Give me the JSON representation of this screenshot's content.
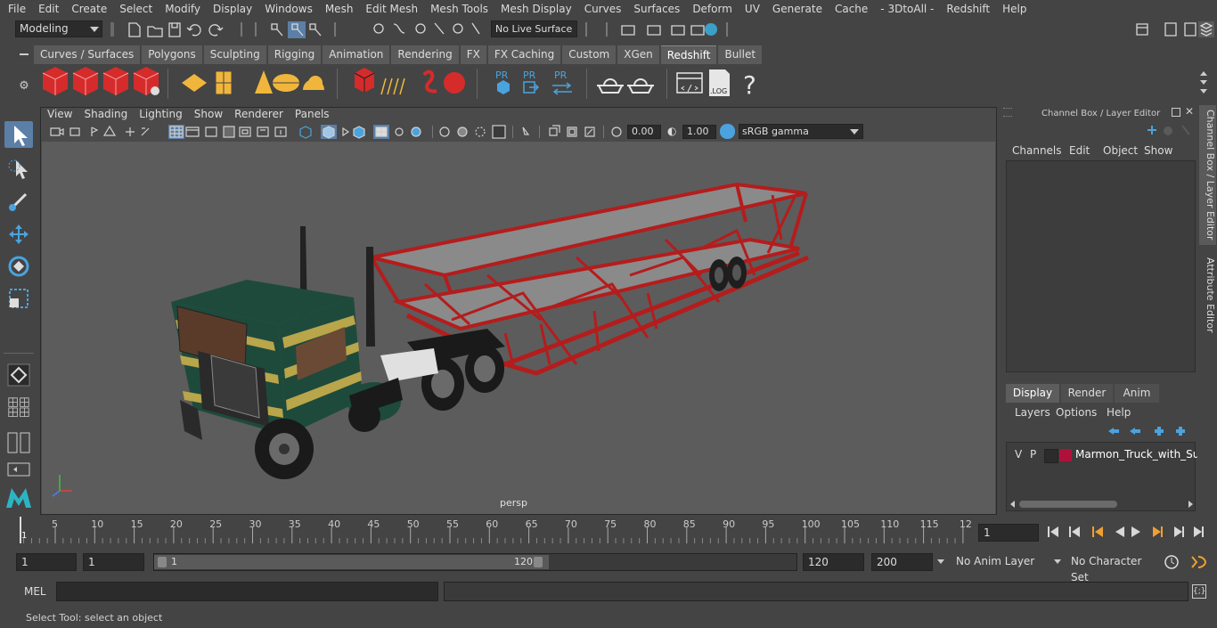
{
  "menubar": [
    "File",
    "Edit",
    "Create",
    "Select",
    "Modify",
    "Display",
    "Windows",
    "Mesh",
    "Edit Mesh",
    "Mesh Tools",
    "Mesh Display",
    "Curves",
    "Surfaces",
    "Deform",
    "UV",
    "Generate",
    "Cache",
    "- 3DtoAll -",
    "Redshift",
    "Help"
  ],
  "status": {
    "mode": "Modeling",
    "live_surface": "No Live Surface"
  },
  "shelf_tabs": [
    "Curves / Surfaces",
    "Polygons",
    "Sculpting",
    "Rigging",
    "Animation",
    "Rendering",
    "FX",
    "FX Caching",
    "Custom",
    "XGen",
    "Redshift",
    "Bullet"
  ],
  "shelf_active": "Redshift",
  "shelf_labels": {
    "rv": "RV",
    "ipr": "IPR",
    "pr1": "PR",
    "pr2": "PR",
    "pr3": "PR",
    "log": ".LOG",
    "help": "?"
  },
  "viewport": {
    "menu": [
      "View",
      "Shading",
      "Lighting",
      "Show",
      "Renderer",
      "Panels"
    ],
    "exposure": "0.00",
    "gamma": "1.00",
    "colorspace": "sRGB gamma",
    "camera": "persp"
  },
  "channel_box": {
    "title": "Channel Box / Layer Editor",
    "menu": [
      "Channels",
      "Edit",
      "Object",
      "Show"
    ]
  },
  "layer_editor": {
    "tabs": [
      "Display",
      "Render",
      "Anim"
    ],
    "active_tab": "Display",
    "menu": [
      "Layers",
      "Options",
      "Help"
    ],
    "layers": [
      {
        "v": "V",
        "p": "P",
        "name": "Marmon_Truck_with_Sun_",
        "color": "#b0113a"
      }
    ]
  },
  "side_tabs": [
    "Channel Box / Layer Editor",
    "Attribute Editor"
  ],
  "timeline": {
    "ticks": [
      "5",
      "10",
      "15",
      "20",
      "25",
      "30",
      "35",
      "40",
      "45",
      "50",
      "55",
      "60",
      "65",
      "70",
      "75",
      "80",
      "85",
      "90",
      "95",
      "100",
      "105",
      "110",
      "115",
      "12"
    ],
    "start_marker": "1",
    "current_frame": "1"
  },
  "range": {
    "start": "1",
    "playback_start": "1",
    "slider_start": "1",
    "slider_end": "120",
    "playback_end": "120",
    "end": "200",
    "anim_layer": "No Anim Layer",
    "character_set": "No Character Set"
  },
  "command": {
    "label": "MEL"
  },
  "help_line": "Select Tool: select an object",
  "colors": {
    "accent_blue": "#4aa3df",
    "shelf_red": "#d62b2b",
    "truck_green": "#1e4a3c",
    "trailer_red": "#b51c1c",
    "stripe_yellow": "#b9a54a"
  }
}
